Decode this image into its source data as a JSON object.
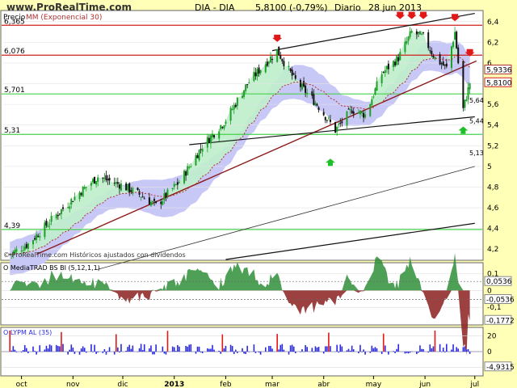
{
  "header": {
    "site": "www.ProRealTime.com",
    "instrument": "DIA - DIA",
    "last_price": "5,8100 (-0,79%)",
    "period": "Diario",
    "date": "28 jun 2013"
  },
  "colors": {
    "background": "#ffffb7",
    "price_up": "#1fa02a",
    "price_down": "#111111",
    "ema": "#b03030",
    "cloud_fill": "#c8c8f7",
    "green_fill": "#bfeecb",
    "resistance_red": "#d0201c",
    "support_green": "#47d24b",
    "osc_pos": "#2f8f3a",
    "osc_neg": "#8b1f1f",
    "vol_blue": "#2a2ae0",
    "vol_red": "#e01818"
  },
  "price_panel": {
    "legend_price": "Precio",
    "legend_ema": "MM (Exponencial 30)",
    "footer_note": "© ProRealTime.com  Históricos ajustados con dividendos",
    "hline_labels": [
      "6,365",
      "6,076",
      "5,701",
      "5,31",
      "4,39"
    ],
    "right_ticks": [
      "6,4",
      "6,2",
      "6",
      "5,8",
      "5,6",
      "5,4",
      "5,2",
      "5",
      "4,8",
      "4,6",
      "4,4",
      "4,2"
    ],
    "price_boxes": [
      "5,9336",
      "5,8100"
    ],
    "side_labels": [
      "5,64",
      "5,44",
      "5,13"
    ]
  },
  "oscillator_panel": {
    "label": "O MediaTRAD BS BI (5,12,1,1)",
    "right_ticks": [
      "0,1",
      "0",
      "-0,1"
    ],
    "value_boxes": [
      "0,0536",
      "-0,0536",
      "-0,1772"
    ]
  },
  "volume_panel": {
    "label": "O LYPM AL (35)",
    "right_ticks": [
      "20",
      "0",
      "-20"
    ],
    "value_box": "-4,9315"
  },
  "x_axis": {
    "labels": [
      "oct",
      "nov",
      "dic",
      "2013",
      "feb",
      "mar",
      "abr",
      "may",
      "jun",
      "jul"
    ]
  },
  "chart_data": {
    "type": "candlestick",
    "x_range": [
      "2012-09-20",
      "2013-07-05"
    ],
    "ylim": [
      4.1,
      6.5
    ],
    "horizontal_levels": [
      6.365,
      6.076,
      5.701,
      5.31,
      4.39
    ],
    "close_path": [
      [
        "2012-09-24",
        4.15
      ],
      [
        "2012-10-05",
        4.25
      ],
      [
        "2012-10-20",
        4.5
      ],
      [
        "2012-11-05",
        4.75
      ],
      [
        "2012-11-16",
        4.9
      ],
      [
        "2012-11-30",
        4.82
      ],
      [
        "2012-12-12",
        4.72
      ],
      [
        "2012-12-21",
        4.62
      ],
      [
        "2013-01-04",
        4.85
      ],
      [
        "2013-01-18",
        5.2
      ],
      [
        "2013-02-01",
        5.45
      ],
      [
        "2013-02-14",
        5.8
      ],
      [
        "2013-02-25",
        6.0
      ],
      [
        "2013-03-04",
        6.12
      ],
      [
        "2013-03-14",
        5.85
      ],
      [
        "2013-03-28",
        5.6
      ],
      [
        "2013-04-08",
        5.35
      ],
      [
        "2013-04-18",
        5.55
      ],
      [
        "2013-04-26",
        5.5
      ],
      [
        "2013-05-06",
        5.9
      ],
      [
        "2013-05-16",
        6.05
      ],
      [
        "2013-05-24",
        6.3
      ],
      [
        "2013-05-31",
        6.25
      ],
      [
        "2013-06-07",
        6.05
      ],
      [
        "2013-06-14",
        5.95
      ],
      [
        "2013-06-19",
        6.3
      ],
      [
        "2013-06-24",
        5.55
      ],
      [
        "2013-06-28",
        5.81
      ]
    ]
  }
}
